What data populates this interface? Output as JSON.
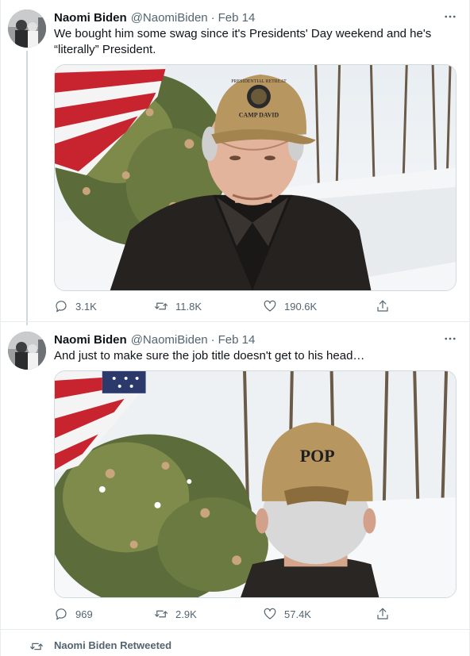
{
  "tweets": [
    {
      "author_name": "Naomi Biden",
      "author_handle": "@NaomiBiden",
      "separator": "·",
      "date": "Feb 14",
      "text": "We bought him some swag since it's Presidents' Day weekend and he's “literally” President.",
      "photo_text": [
        "PRESIDENTIAL RETREAT",
        "CAMP DAVID"
      ],
      "stats": {
        "replies": "3.1K",
        "retweets": "11.8K",
        "likes": "190.6K"
      }
    },
    {
      "author_name": "Naomi Biden",
      "author_handle": "@NaomiBiden",
      "separator": "·",
      "date": "Feb 14",
      "text": "And just to make sure the job title doesn't get to his head…",
      "photo_text": [
        "POP"
      ],
      "stats": {
        "replies": "969",
        "retweets": "2.9K",
        "likes": "57.4K"
      }
    }
  ],
  "retweet_banner": {
    "text": "Naomi Biden Retweeted"
  },
  "icons": {
    "more": "more-horizontal-icon",
    "reply": "reply-bubble-icon",
    "retweet": "retweet-arrows-icon",
    "like": "heart-icon",
    "share": "share-upload-icon"
  },
  "colors": {
    "text_primary": "#0f1419",
    "text_secondary": "#536471",
    "border": "#e6ecf0"
  }
}
